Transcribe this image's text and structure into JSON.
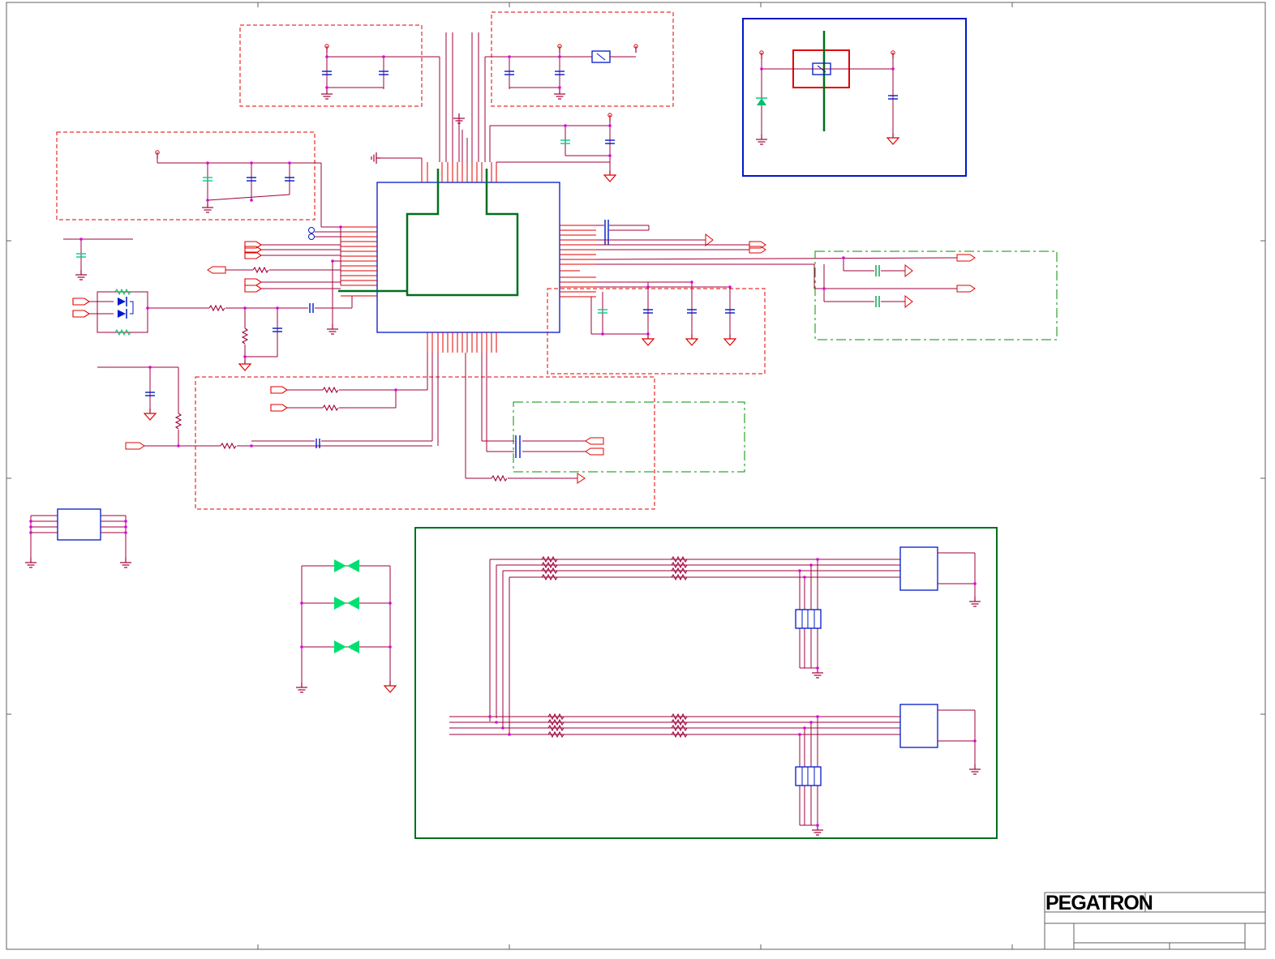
{
  "title_block": {
    "logo": "PEGATRON"
  },
  "colors": {
    "wire": "#a0003c",
    "red_wire": "#e00000",
    "blue": "#0018c8",
    "green": "#006f1f",
    "bright_green": "#00e070",
    "magenta": "#e000e0",
    "frame": "#606060"
  }
}
